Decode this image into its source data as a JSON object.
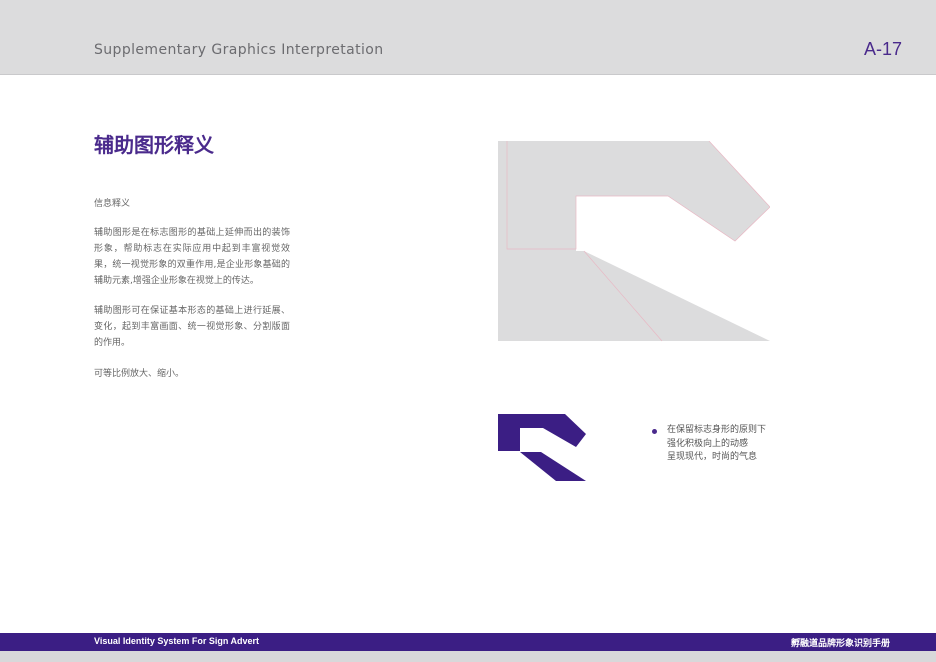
{
  "header": {
    "title": "Supplementary Graphics Interpretation",
    "page_number": "A-17"
  },
  "content": {
    "section_title": "辅助图形释义",
    "sub_heading": "信息释义",
    "paragraph_1": "辅助图形是在标志图形的基础上延伸而出的装饰形象，帮助标志在实际应用中起到丰富视觉效果，统一视觉形象的双重作用,是企业形象基础的辅助元素,增强企业形象在视觉上的传达。",
    "paragraph_2": "辅助图形可在保证基本形态的基础上进行延展、变化，起到丰富画面、统一视觉形象、分割版面的作用。",
    "paragraph_3": "可等比例放大、缩小。"
  },
  "bullet": {
    "lines": [
      "在保留标志身形的原则下",
      "强化积极向上的动感",
      "呈现现代，时尚的气息"
    ]
  },
  "footer": {
    "left_text": "Visual Identity System For Sign Advert",
    "right_text": "孵融道品牌形象识别手册"
  },
  "colors": {
    "brand_purple": "#4a2a8c",
    "footer_purple": "#3b1e84",
    "graphic_gray": "#dcdcdd",
    "header_gray": "#dcdcdd"
  }
}
